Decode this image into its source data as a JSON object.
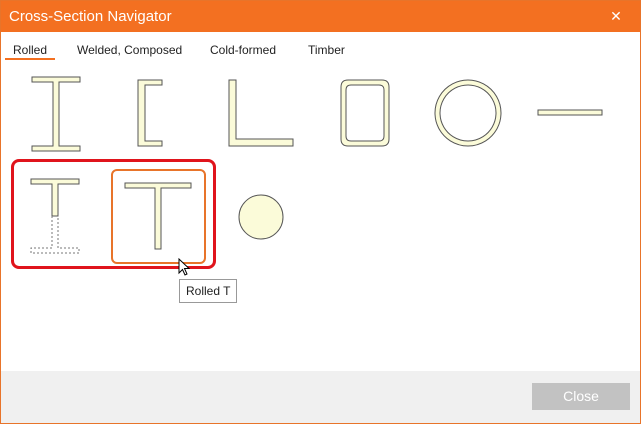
{
  "window": {
    "title": "Cross-Section Navigator"
  },
  "tabs": [
    {
      "label": "Rolled",
      "active": true
    },
    {
      "label": "Welded, Composed"
    },
    {
      "label": "Cold-formed"
    },
    {
      "label": "Timber"
    }
  ],
  "sections": [
    "i-beam-icon",
    "channel-icon",
    "angle-icon",
    "rectangular-tube-icon",
    "round-tube-icon",
    "flat-bar-icon",
    "half-i-beam-icon",
    "rolled-t-icon",
    "round-bar-icon"
  ],
  "tooltip": {
    "text": "Rolled T"
  },
  "footer": {
    "close_label": "Close"
  },
  "colors": {
    "accent": "#f37021",
    "section_fill": "#fbfbd9",
    "highlight": "#e0141c"
  }
}
